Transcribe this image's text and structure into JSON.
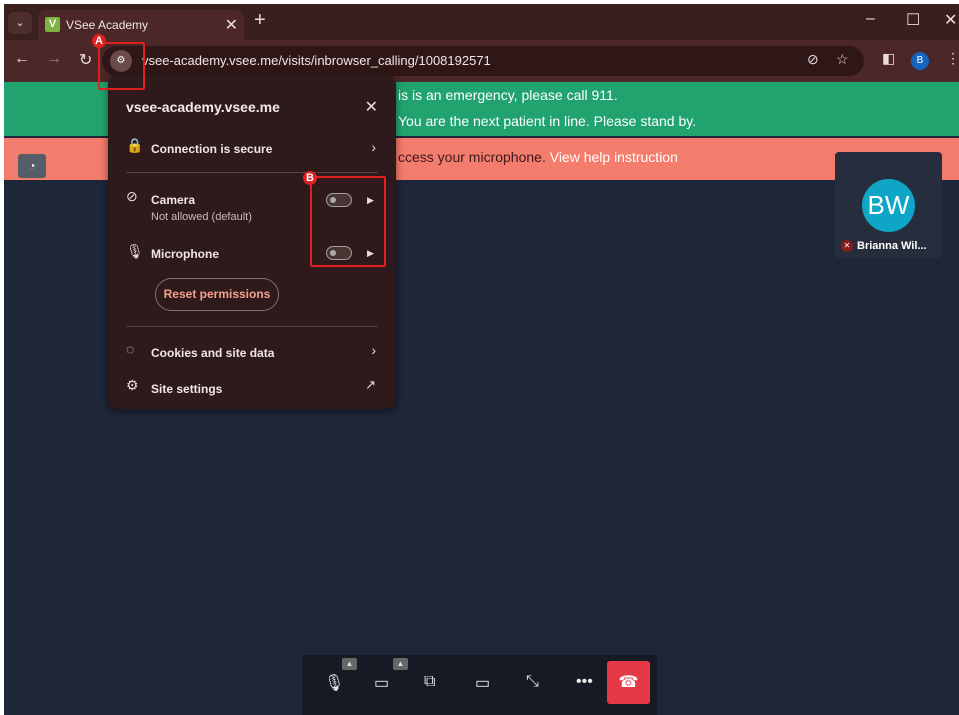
{
  "browser": {
    "tab_menu_icon": "chevron-down-icon",
    "tab_title": "VSee Academy",
    "favicon_letter": "V",
    "tab_close": "✕",
    "new_tab": "+",
    "window_controls": {
      "minimize": "–",
      "maximize": "☐",
      "close": "✕"
    },
    "url": "vsee-academy.vsee.me/visits/inbrowser_calling/1008192571",
    "profile_initial": "B"
  },
  "page": {
    "green_line1": "is is an emergency, please call 911.",
    "green_line2": "You are the next patient in line. Please stand by.",
    "red_message": "ccess your microphone.",
    "red_link": "View help instruction"
  },
  "participant": {
    "initials": "BW",
    "name": "Brianna Wil..."
  },
  "popup": {
    "site": "vsee-academy.vsee.me",
    "connection": "Connection is secure",
    "camera_label": "Camera",
    "camera_sub": "Not allowed (default)",
    "microphone_label": "Microphone",
    "reset_label": "Reset permissions",
    "cookies_label": "Cookies and site data",
    "site_settings_label": "Site settings"
  },
  "annotations": {
    "a_label": "A",
    "b_label": "B"
  },
  "colors": {
    "accent_red": "#e02020",
    "green_banner": "#20a36e",
    "red_banner": "#f47c6c",
    "hangup": "#e53948"
  }
}
